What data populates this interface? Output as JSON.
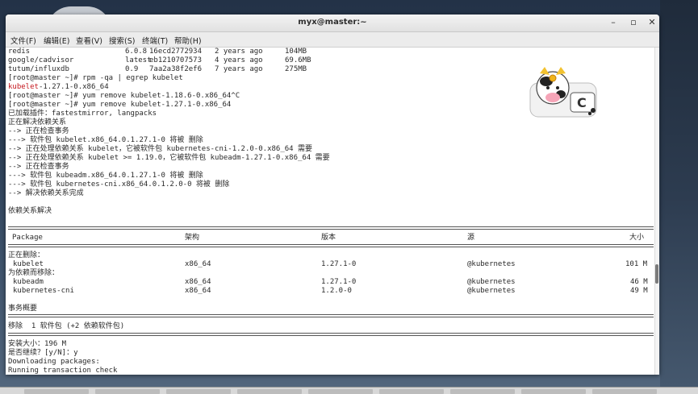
{
  "window": {
    "title": "myx@master:~",
    "controls": {
      "minimize": "–",
      "maximize": "▫",
      "close": "✕"
    }
  },
  "menu": [
    "文件(F)",
    "编辑(E)",
    "查看(V)",
    "搜索(S)",
    "终端(T)",
    "帮助(H)"
  ],
  "docker_images": [
    {
      "repo": "redis",
      "tag": "6.0.8",
      "id": "16ecd2772934",
      "age": "2 years ago",
      "size": "104MB"
    },
    {
      "repo": "google/cadvisor",
      "tag": "latest",
      "id": "eb1210707573",
      "age": "4 years ago",
      "size": "69.6MB"
    },
    {
      "repo": "tutum/influxdb",
      "tag": "0.9",
      "id": "7aa2a38f2ef6",
      "age": "7 years ago",
      "size": "275MB"
    }
  ],
  "lines": {
    "prompt1": "[root@master ~]# rpm -qa | egrep kubelet",
    "kubelet_pkg_name": "kubelet",
    "kubelet_pkg_rest": "-1.27.1-0.x86_64",
    "prompt2": "[root@master ~]# yum remove kubelet-1.18.6-0.x86_64^C",
    "prompt3": "[root@master ~]# yum remove kubelet-1.27.1-0.x86_64",
    "l1": "已加载插件：fastestmirror, langpacks",
    "l2": "正在解决依赖关系",
    "l3": "--> 正在检查事务",
    "l4": "---> 软件包 kubelet.x86_64.0.1.27.1-0 将被 删除",
    "l5": "--> 正在处理依赖关系 kubelet，它被软件包 kubernetes-cni-1.2.0-0.x86_64 需要",
    "l6": "--> 正在处理依赖关系 kubelet >= 1.19.0，它被软件包 kubeadm-1.27.1-0.x86_64 需要",
    "l7": "--> 正在检查事务",
    "l8": "---> 软件包 kubeadm.x86_64.0.1.27.1-0 将被 删除",
    "l9": "---> 软件包 kubernetes-cni.x86_64.0.1.2.0-0 将被 删除",
    "l10": "--> 解决依赖关系完成",
    "l11": "依赖关系解决",
    "removing_label": "正在删除：",
    "deps_label": "为依赖而移除：",
    "summary": "事务概要",
    "remove_line": "移除  1 软件包 (+2 依赖软件包)",
    "install_size": "安装大小：196 M",
    "confirm": "是否继续？[y/N]：y",
    "downloading": "Downloading packages:",
    "running": "Running transaction check"
  },
  "table": {
    "headers": {
      "package": "Package",
      "arch": "架构",
      "version": "版本",
      "repo": "源",
      "size": "大小"
    },
    "removing": [
      {
        "package": "kubelet",
        "arch": "x86_64",
        "version": "1.27.1-0",
        "repo": "@kubernetes",
        "size": "101 M"
      }
    ],
    "deps": [
      {
        "package": "kubeadm",
        "arch": "x86_64",
        "version": "1.27.1-0",
        "repo": "@kubernetes",
        "size": "46 M"
      },
      {
        "package": "kubernetes-cni",
        "arch": "x86_64",
        "version": "1.2.0-0",
        "repo": "@kubernetes",
        "size": "49 M"
      }
    ]
  },
  "sticker": {
    "letter": "C"
  },
  "colors": {
    "error_red": "#c4151c",
    "terminal_bg": "#ffffff"
  }
}
